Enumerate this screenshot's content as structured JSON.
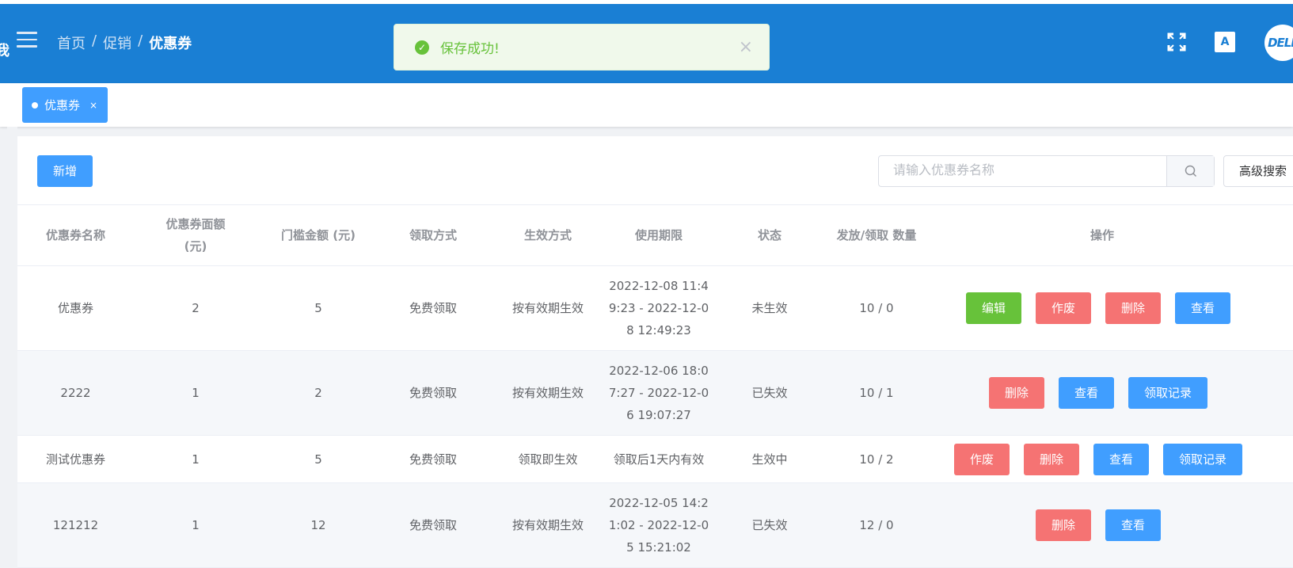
{
  "header": {
    "breadcrumb": [
      "首页",
      "促销",
      "优惠券"
    ],
    "avatar_text": "DELL"
  },
  "toast": {
    "message": "保存成功!"
  },
  "tags": [
    {
      "label": "优惠券",
      "close": "×"
    }
  ],
  "toolbar": {
    "add_label": "新增",
    "search_placeholder": "请输入优惠券名称",
    "advanced_search_label": "高级搜索"
  },
  "table": {
    "columns": [
      "优惠券名称",
      "优惠券面额(元)",
      "门槛金额 (元)",
      "领取方式",
      "生效方式",
      "使用期限",
      "状态",
      "发放/领取 数量",
      "操作"
    ],
    "rows": [
      {
        "name": "优惠券",
        "face": "2",
        "threshold": "5",
        "receive": "免费领取",
        "effect": "按有效期生效",
        "period": "2022-12-08 11:49:23 - 2022-12-08 12:49:23",
        "status": "未生效",
        "qty": "10 / 0",
        "actions": [
          "编辑",
          "作废",
          "删除",
          "查看"
        ]
      },
      {
        "name": "2222",
        "face": "1",
        "threshold": "2",
        "receive": "免费领取",
        "effect": "按有效期生效",
        "period": "2022-12-06 18:07:27 - 2022-12-06 19:07:27",
        "status": "已失效",
        "qty": "10 / 1",
        "actions": [
          "删除",
          "查看",
          "领取记录"
        ]
      },
      {
        "name": "测试优惠券",
        "face": "1",
        "threshold": "5",
        "receive": "免费领取",
        "effect": "领取即生效",
        "period": "领取后1天内有效",
        "status": "生效中",
        "qty": "10 / 2",
        "actions": [
          "作废",
          "删除",
          "查看",
          "领取记录"
        ]
      },
      {
        "name": "121212",
        "face": "1",
        "threshold": "12",
        "receive": "免费领取",
        "effect": "按有效期生效",
        "period": "2022-12-05 14:21:02 - 2022-12-05 15:21:02",
        "status": "已失效",
        "qty": "12 / 0",
        "actions": [
          "删除",
          "查看"
        ]
      }
    ]
  },
  "colors": {
    "header": "#1a7fd4",
    "primary": "#409eff",
    "success": "#67c23a",
    "danger": "#f56c6c"
  }
}
